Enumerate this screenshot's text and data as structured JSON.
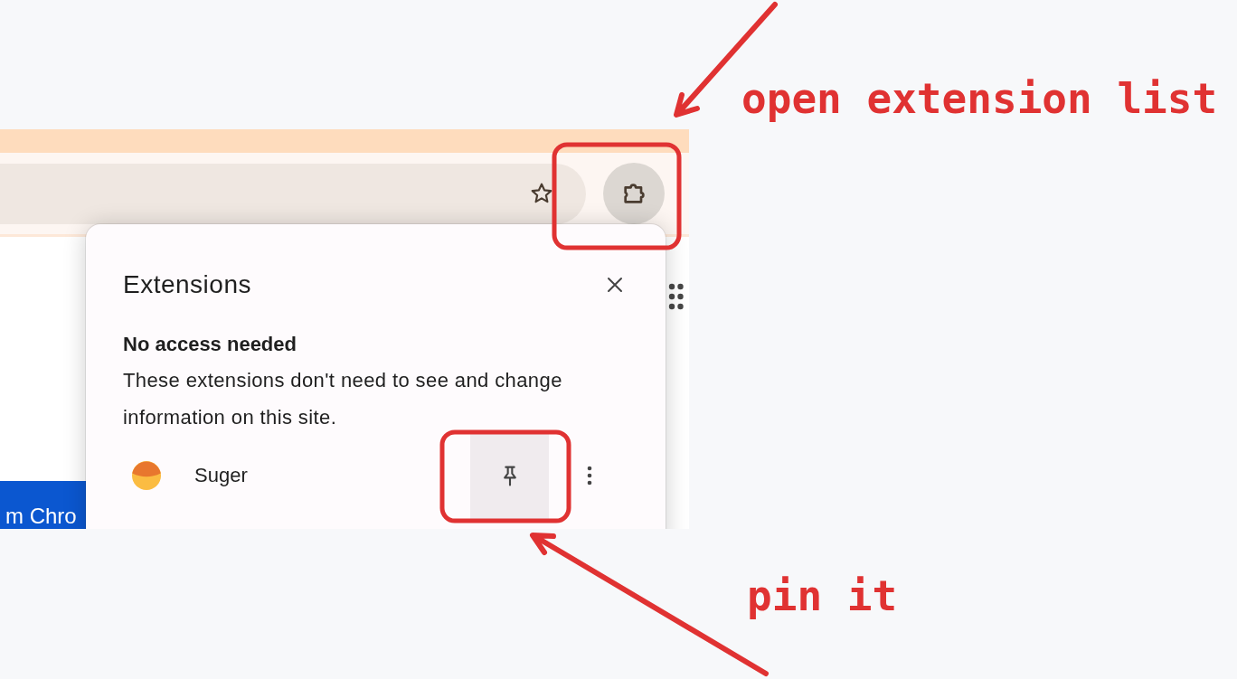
{
  "browser": {
    "page_button": "m Chro"
  },
  "extensions_popup": {
    "title": "Extensions",
    "section_heading": "No access needed",
    "section_description": "These extensions don't need to see and change information on this site.",
    "extensions": [
      {
        "name": "Suger",
        "pin_highlighted": true
      }
    ]
  },
  "annotations": [
    {
      "text": "open extension list"
    },
    {
      "text": "pin it"
    }
  ]
}
